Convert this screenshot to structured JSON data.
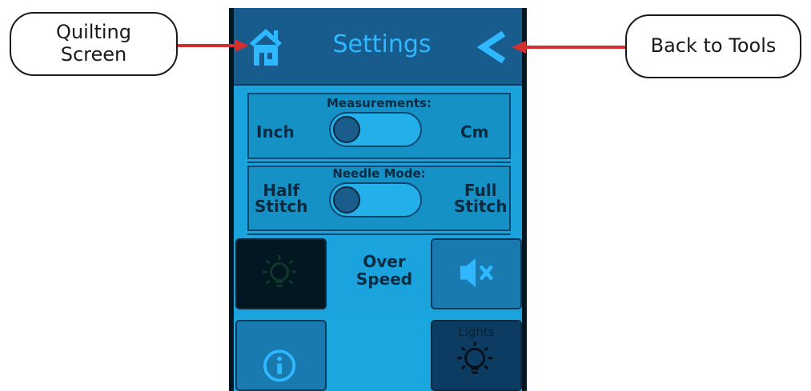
{
  "callouts": {
    "quilting_screen": [
      "Quilting",
      "Screen"
    ],
    "back_to_tools": "Back to Tools"
  },
  "header": {
    "title": "Settings",
    "home_icon": "home-icon",
    "back_icon": "chevron-left-icon"
  },
  "measurements": {
    "label": "Measurements:",
    "left_option": "Inch",
    "right_option": "Cm",
    "selected": "Inch"
  },
  "needle_mode": {
    "label": "Needle Mode:",
    "left_option": [
      "Half",
      "Stitch"
    ],
    "right_option": [
      "Full",
      "Stitch"
    ],
    "selected": "Half Stitch"
  },
  "buttons": {
    "light_icon": "lightbulb-icon",
    "over_speed": [
      "Over",
      "Speed"
    ],
    "sound_icon": "mute-speaker-icon",
    "info_icon": "info-icon",
    "lights_label": "Lights"
  },
  "colors": {
    "screen_bg": "#1aa3dc",
    "header_bg": "#185c8e",
    "title_color": "#2fb8ff",
    "arrow_red": "#d32f2f"
  }
}
